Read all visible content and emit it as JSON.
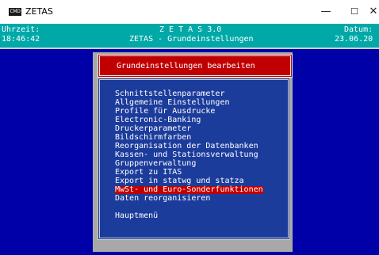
{
  "window": {
    "title": "ZETAS",
    "icon_label": "CMD"
  },
  "header": {
    "time_label": "Uhrzeit:",
    "time_value": "18:46:42",
    "app_name": "Z E T A S 3.0",
    "screen_title": "ZETAS - Grundeinstellungen",
    "date_label": "Datum:",
    "date_value": "23.06.20"
  },
  "menu": {
    "title": "Grundeinstellungen bearbeiten",
    "items": [
      "Schnittstellenparameter",
      "Allgemeine Einstellungen",
      "Profile für Ausdrucke",
      "Electronic-Banking",
      "Druckerparameter",
      "Bildschirmfarben",
      "Reorganisation der Datenbanken",
      "Kassen- und Stationsverwaltung",
      "Gruppenverwaltung",
      "Export zu ITAS",
      "Export in statwg und statza",
      "MwSt- und Euro-Sonderfunktionen",
      "Daten reorganisieren",
      "Hauptmenü"
    ],
    "selected_index": 11
  },
  "colors": {
    "desktop": "#0000a8",
    "header": "#00a8a8",
    "highlight": "#c00000",
    "panel": "#a8a8a8",
    "menu_bg": "#1c3c9c"
  },
  "icons": {
    "minimize": "minimize-icon",
    "maximize": "maximize-icon",
    "close": "close-icon"
  }
}
